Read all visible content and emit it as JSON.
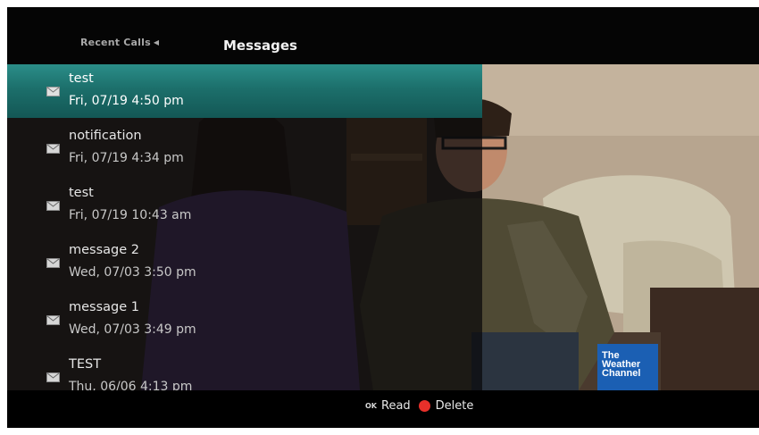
{
  "header": {
    "tab_recent_calls": "Recent Calls",
    "tab_recent_arrow_icon": "triangle-left-icon",
    "tab_messages": "Messages"
  },
  "messages": [
    {
      "title": "test",
      "date": "Fri, 07/19 4:50 pm",
      "selected": true,
      "icon": "envelope-icon"
    },
    {
      "title": "notification",
      "date": "Fri, 07/19 4:34 pm",
      "selected": false,
      "icon": "envelope-icon"
    },
    {
      "title": "test",
      "date": "Fri, 07/19 10:43 am",
      "selected": false,
      "icon": "envelope-icon"
    },
    {
      "title": "message 2",
      "date": "Wed, 07/03 3:50 pm",
      "selected": false,
      "icon": "envelope-icon"
    },
    {
      "title": "message 1",
      "date": "Wed, 07/03 3:49 pm",
      "selected": false,
      "icon": "envelope-icon"
    },
    {
      "title": "TEST",
      "date": "Thu, 06/06 4:13 pm",
      "selected": false,
      "icon": "envelope-icon"
    }
  ],
  "footer": {
    "ok_key": "OK",
    "read_label": "Read",
    "delete_label": "Delete",
    "delete_color": "#e8302a"
  },
  "channel_logo": {
    "line1": "The",
    "line2": "Weather",
    "line3": "Channel",
    "color": "#1b5fb3"
  },
  "colors": {
    "selection": "#1c6f6b",
    "background": "#000000"
  }
}
